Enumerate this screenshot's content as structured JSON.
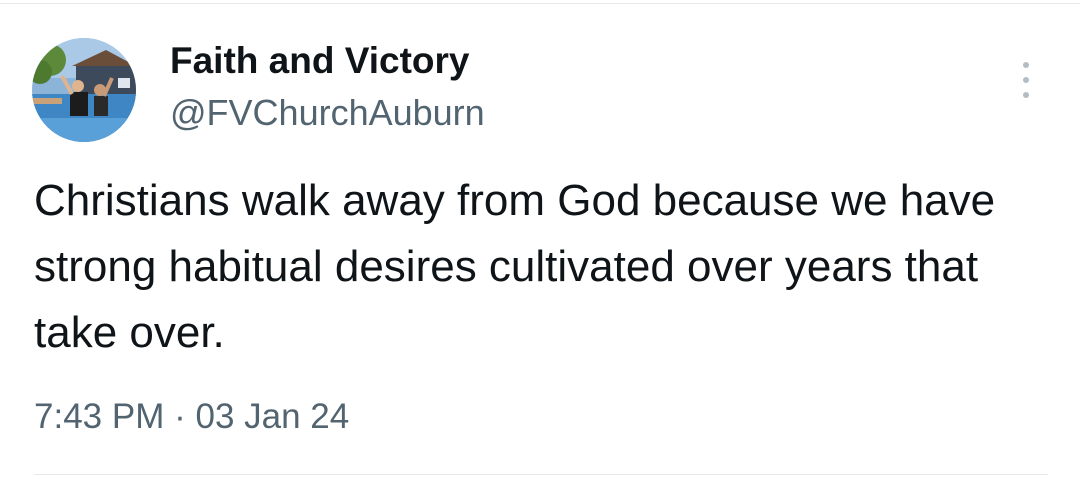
{
  "tweet": {
    "author": {
      "display_name": "Faith and Victory",
      "handle": "@FVChurchAuburn",
      "avatar": "profile-photo"
    },
    "text": "Christians walk away from God because we have strong habitual desires cultivated over years that take over.",
    "time": "7:43 PM",
    "separator": "·",
    "date": "03 Jan 24",
    "more_icon": "more-vertical-icon"
  },
  "colors": {
    "primary_text": "#0f1419",
    "secondary_text": "#536471",
    "divider": "#e6e9ec",
    "more_icon": "#b4bcc4"
  }
}
